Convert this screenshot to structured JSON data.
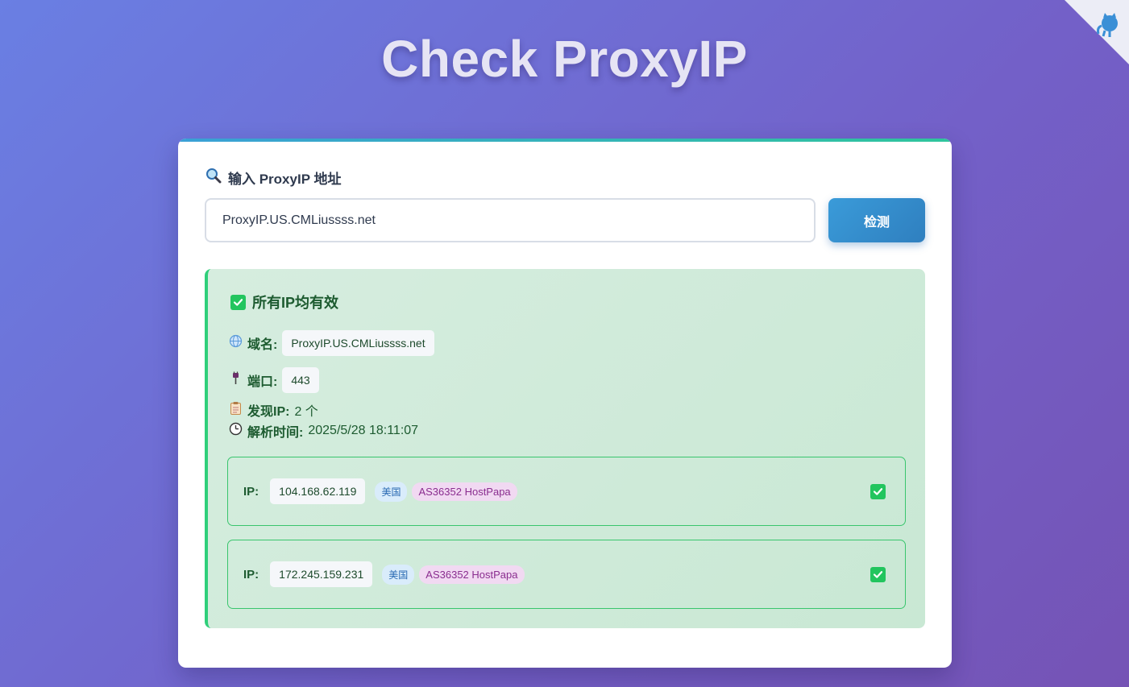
{
  "header": {
    "title": "Check ProxyIP"
  },
  "form": {
    "label": "输入 ProxyIP 地址",
    "input_value": "ProxyIP.US.CMLiussss.net",
    "button_label": "检测"
  },
  "result": {
    "status_title": "所有IP均有效",
    "domain_label": "域名:",
    "domain_value": "ProxyIP.US.CMLiussss.net",
    "port_label": "端口:",
    "port_value": "443",
    "found_label": "发现IP:",
    "found_value": "2 个",
    "time_label": "解析时间:",
    "time_value": "2025/5/28 18:11:07",
    "ips": [
      {
        "label": "IP:",
        "address": "104.168.62.119",
        "country": "美国",
        "asn": "AS36352 HostPapa"
      },
      {
        "label": "IP:",
        "address": "172.245.159.231",
        "country": "美国",
        "asn": "AS36352 HostPapa"
      }
    ]
  },
  "colors": {
    "accent": "#3a9bd9",
    "success": "#22c55e",
    "success_text": "#1d5b30"
  },
  "icons": {
    "corner": "github-icon",
    "label": "magnifier-icon",
    "status": "check-icon",
    "domain": "globe-icon",
    "port": "plug-icon",
    "found": "clipboard-icon",
    "time": "clock-icon"
  }
}
